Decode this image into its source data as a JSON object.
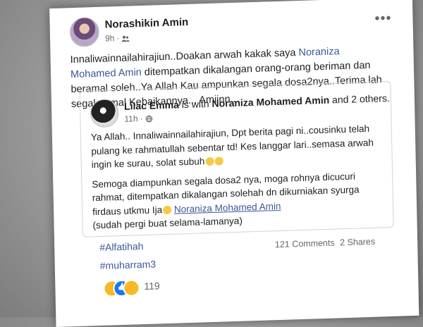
{
  "post": {
    "author": "Norashikin Amin",
    "time": "9h",
    "separator": "·",
    "text_before": "Innaliwainnailahirajiun..Doakan arwah kakak saya ",
    "mention": "Noraniza Mohamed Amin",
    "text_after": " ditempatkan dikalangan orang-orang beriman dan beramal soleh..Ya Allah Kau ampunkan segala dosa2nya..Terima lah segala amal Kebaikannya... Amiinn..."
  },
  "shared_post": {
    "author": "Lilac Emma",
    "is_with": " is with ",
    "tagged": "Noraniza Mohamed Amin",
    "and_others": " and 2 others.",
    "time": "11h",
    "separator": "·",
    "para1": "Ya Allah.. Innaliwainnailahirajiun, Dpt berita pagi ni..cousinku telah pulang ke rahmatullah sebentar td! Kes langgar lari..semasa arwah ingin ke surau, solat subuh",
    "para2_before": "Semoga diampunkan segala dosa2 nya, moga rohnya dicucuri rahmat, ditempatkan dikalangan solehah dn dikurniakan syurga firdaus utkmu Ija",
    "para2_mention": "Noraniza Mohamed Amin",
    "para2_after": "(sudah pergi buat selama-lamanya)"
  },
  "hashtags": [
    "#Alfatihah",
    "#muharram3"
  ],
  "counts": {
    "comments": "121 Comments",
    "shares": "2 Shares"
  },
  "reactions": {
    "count": "119",
    "icons": [
      "sad-icon",
      "like-icon",
      "care-icon"
    ]
  },
  "colors": {
    "link": "#385898",
    "text": "#1c1e21",
    "meta": "#65676b"
  }
}
